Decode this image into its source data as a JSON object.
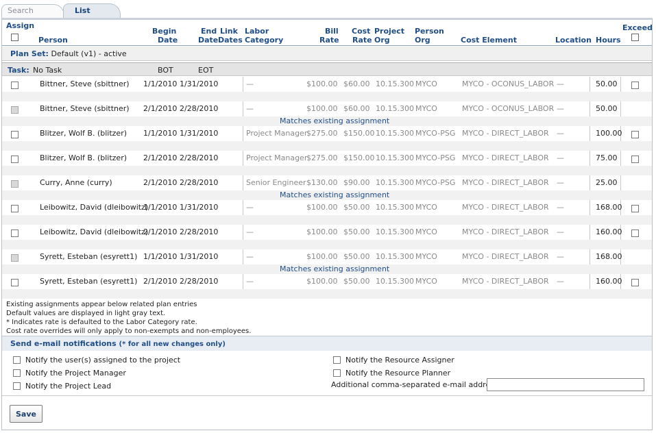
{
  "tabs": {
    "search": "Search",
    "list": "List"
  },
  "header": {
    "assign": "Assign",
    "person": "Person",
    "begin_date_1": "Begin",
    "begin_date_2": "Date",
    "end_date_1": "End",
    "end_date_2": "Date",
    "link_dates_1": "Link",
    "link_dates_2": "Dates",
    "labor_category_1": "Labor",
    "labor_category_2": "Category",
    "bill_rate_1": "Bill",
    "bill_rate_2": "Rate",
    "cost_rate_1": "Cost",
    "cost_rate_2": "Rate",
    "project_org_1": "Project",
    "project_org_2": "Org",
    "person_org_1": "Person",
    "person_org_2": "Org",
    "cost_element": "Cost Element",
    "location": "Location",
    "hours": "Hours",
    "exceed": "Exceed"
  },
  "plan_set": {
    "label": "Plan Set:",
    "value": "Default (v1) - active"
  },
  "task": {
    "label": "Task:",
    "value": "No Task",
    "bot": "BOT",
    "eot": "EOT"
  },
  "match_text": "Matches existing assignment",
  "rows": [
    {
      "person": "Bittner, Steve (sbittner)",
      "begin": "1/1/2010",
      "end": "1/31/2010",
      "labor": "—",
      "bill": "$100.00",
      "cost": "$60.00",
      "porg": "10.15.300",
      "perorg": "MYCO",
      "element": "MYCO - OCONUS_LABOR",
      "location": "—",
      "hours": "50.00"
    },
    {
      "person": "Bittner, Steve (sbittner)",
      "begin": "2/1/2010",
      "end": "2/28/2010",
      "labor": "—",
      "bill": "$100.00",
      "cost": "$60.00",
      "porg": "10.15.300",
      "perorg": "MYCO",
      "element": "MYCO - OCONUS_LABOR",
      "location": "—",
      "hours": "50.00"
    },
    {
      "person": "Blitzer, Wolf B. (blitzer)",
      "begin": "1/1/2010",
      "end": "1/31/2010",
      "labor": "Project Manager",
      "bill": "$275.00",
      "cost": "$150.00",
      "porg": "10.15.300",
      "perorg": "MYCO-PSG",
      "element": "MYCO - DIRECT_LABOR",
      "location": "—",
      "hours": "100.00"
    },
    {
      "person": "Blitzer, Wolf B. (blitzer)",
      "begin": "2/1/2010",
      "end": "2/28/2010",
      "labor": "Project Manager",
      "bill": "$275.00",
      "cost": "$150.00",
      "porg": "10.15.300",
      "perorg": "MYCO-PSG",
      "element": "MYCO - DIRECT_LABOR",
      "location": "—",
      "hours": "75.00"
    },
    {
      "person": "Curry, Anne (curry)",
      "begin": "2/1/2010",
      "end": "2/28/2010",
      "labor": "Senior Engineer",
      "bill": "$130.00",
      "cost": "$90.00",
      "porg": "10.15.300",
      "perorg": "MYCO-PSG",
      "element": "MYCO - DIRECT_LABOR",
      "location": "—",
      "hours": "25.00"
    },
    {
      "person": "Leibowitz, David (dleibowitz)",
      "begin": "1/1/2010",
      "end": "1/31/2010",
      "labor": "—",
      "bill": "$100.00",
      "cost": "$50.00",
      "porg": "10.15.300",
      "perorg": "MYCO",
      "element": "MYCO - DIRECT_LABOR",
      "location": "—",
      "hours": "168.00"
    },
    {
      "person": "Leibowitz, David (dleibowitz)",
      "begin": "2/1/2010",
      "end": "2/28/2010",
      "labor": "—",
      "bill": "$100.00",
      "cost": "$50.00",
      "porg": "10.15.300",
      "perorg": "MYCO",
      "element": "MYCO - DIRECT_LABOR",
      "location": "—",
      "hours": "160.00"
    },
    {
      "person": "Syrett, Esteban (esyrett1)",
      "begin": "1/1/2010",
      "end": "1/31/2010",
      "labor": "—",
      "bill": "$100.00",
      "cost": "$50.00",
      "porg": "10.15.300",
      "perorg": "MYCO",
      "element": "MYCO - DIRECT_LABOR",
      "location": "—",
      "hours": "168.00"
    },
    {
      "person": "Syrett, Esteban (esyrett1)",
      "begin": "2/1/2010",
      "end": "2/28/2010",
      "labor": "—",
      "bill": "$100.00",
      "cost": "$50.00",
      "porg": "10.15.300",
      "perorg": "MYCO",
      "element": "MYCO - DIRECT_LABOR",
      "location": "—",
      "hours": "160.00"
    }
  ],
  "notes": [
    "Existing assignments appear below related plan entries",
    "Default values are displayed in light gray text.",
    "* Indicates rate is defaulted to the Labor Category rate.",
    "Cost rate overrides will only apply to non-exempts and non-employees."
  ],
  "email": {
    "title": "Send e-mail notifications",
    "subtitle": "(* for all new changes only)",
    "notify_assigned": "Notify the user(s) assigned to the project",
    "notify_pm": "Notify the Project Manager",
    "notify_lead": "Notify the Project Lead",
    "notify_assigner": "Notify the Resource Assigner",
    "notify_planner": "Notify the Resource Planner",
    "additional_label": "Additional comma-separated e-mail addresses",
    "additional_value": ""
  },
  "buttons": {
    "save": "Save"
  }
}
